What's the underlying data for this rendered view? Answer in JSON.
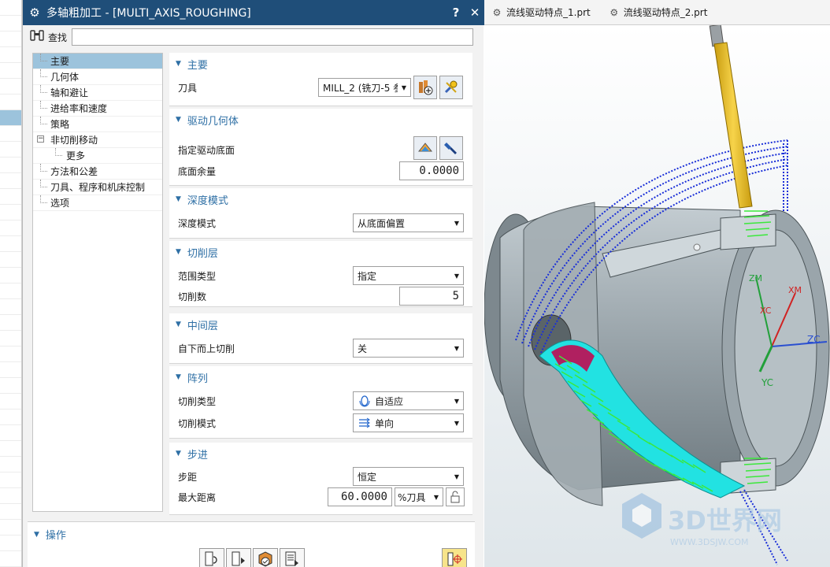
{
  "dialog": {
    "title": "多轴粗加工 - [MULTI_AXIS_ROUGHING]",
    "help_glyph": "?",
    "close_glyph": "✕",
    "search_label": "查找",
    "search_value": ""
  },
  "nav": {
    "items": [
      {
        "label": "主要",
        "selected": true
      },
      {
        "label": "几何体"
      },
      {
        "label": "轴和避让"
      },
      {
        "label": "进给率和速度"
      },
      {
        "label": "策略"
      },
      {
        "label": "非切削移动",
        "collapse": "−"
      },
      {
        "label": "更多",
        "indent": true
      },
      {
        "label": "方法和公差"
      },
      {
        "label": "刀具、程序和机床控制"
      },
      {
        "label": "选项"
      }
    ]
  },
  "groups": {
    "main": {
      "title": "主要",
      "tool_label": "刀具",
      "tool_value": "MILL_2 (铣刀-5 参"
    },
    "drive": {
      "title": "驱动几何体",
      "floor_label": "指定驱动底面",
      "stock_label": "底面余量",
      "stock_value": "0.0000"
    },
    "depth": {
      "title": "深度模式",
      "mode_label": "深度模式",
      "mode_value": "从底面偏置"
    },
    "cut_levels": {
      "title": "切削层",
      "range_label": "范围类型",
      "range_value": "指定",
      "count_label": "切削数",
      "count_value": "5"
    },
    "middle": {
      "title": "中间层",
      "bottom_up_label": "自下而上切削",
      "bottom_up_value": "关"
    },
    "pattern": {
      "title": "阵列",
      "cut_type_label": "切削类型",
      "cut_type_value": "自适应",
      "cut_mode_label": "切削模式",
      "cut_mode_value": "单向"
    },
    "stepover": {
      "title": "步进",
      "step_label": "步距",
      "step_value": "恒定",
      "max_label": "最大距离",
      "max_value": "60.0000",
      "max_unit": "%刀具"
    }
  },
  "ops": {
    "title": "操作"
  },
  "file_tabs": [
    "流线驱动特点_1.prt",
    "流线驱动特点_2.prt"
  ],
  "scene": {
    "axis_labels": {
      "zm": "ZM",
      "xm": "XM",
      "xc": "XC",
      "zc": "ZC",
      "yc": "YC"
    },
    "watermark": "3D世界网",
    "watermark_url": "WWW.3DSJW.COM"
  },
  "colors": {
    "title_bar": "#1f4e79",
    "group_title": "#2e6fa5",
    "nav_selected": "#9cc3dc",
    "part_gray": "#b8c2c8",
    "tool_yellow": "#f2c21a",
    "toolpath_blue": "#1a2fd8",
    "toolpath_green": "#32e632",
    "toolpath_cyan": "#20e6e6"
  }
}
